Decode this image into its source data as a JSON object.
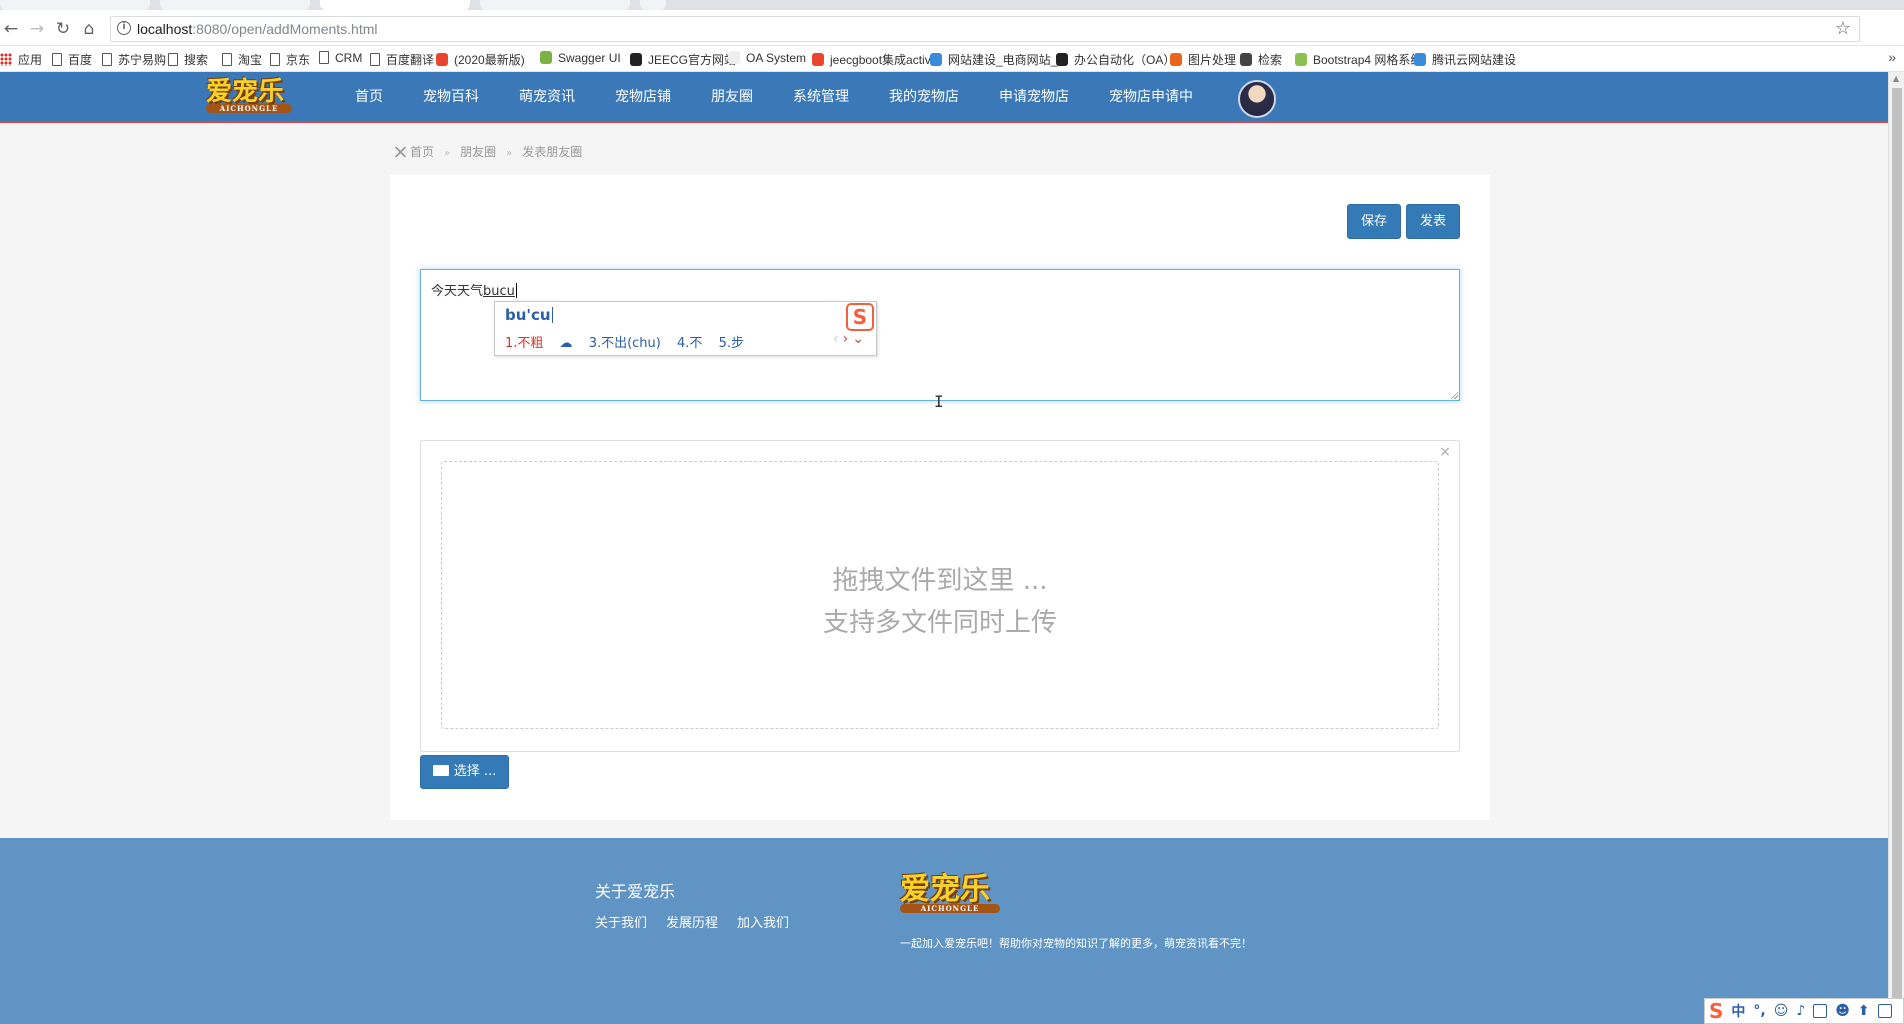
{
  "browser": {
    "url_host": "localhost",
    "url_rest": ":8080/open/addMoments.html",
    "bookmarks": [
      {
        "label": "应用",
        "icon": "apps-grid-icon"
      },
      {
        "label": "百度",
        "icon": "page-icon"
      },
      {
        "label": "苏宁易购",
        "icon": "page-icon"
      },
      {
        "label": "搜索",
        "icon": "page-icon"
      },
      {
        "label": "淘宝",
        "icon": "page-icon"
      },
      {
        "label": "京东",
        "icon": "page-icon"
      },
      {
        "label": "CRM",
        "icon": "page-icon"
      },
      {
        "label": "百度翻译",
        "icon": "page-icon"
      },
      {
        "label": "(2020最新版)",
        "icon": "c-brand-icon"
      },
      {
        "label": "Swagger UI",
        "icon": "swagger-icon"
      },
      {
        "label": "JEECG官方网站",
        "icon": "jeecg-icon"
      },
      {
        "label": "OA System",
        "icon": "blank-icon"
      },
      {
        "label": "jeecgboot集成activ",
        "icon": "g-brand-icon"
      },
      {
        "label": "网站建设_电商网站_",
        "icon": "cloud-icon"
      },
      {
        "label": "办公自动化（OA）",
        "icon": "github-icon"
      },
      {
        "label": "图片处理",
        "icon": "office-icon"
      },
      {
        "label": "检索",
        "icon": "fx-icon"
      },
      {
        "label": "Bootstrap4 网格系统",
        "icon": "bootstrap-icon"
      },
      {
        "label": "腾讯云网站建设",
        "icon": "cloud-icon"
      }
    ],
    "more_glyph": "»"
  },
  "site": {
    "logo_text": "爱宠乐",
    "logo_sub": "AICHONGLE",
    "nav": [
      "首页",
      "宠物百科",
      "萌宠资讯",
      "宠物店铺",
      "朋友圈",
      "系统管理",
      "我的宠物店",
      "申请宠物店",
      "宠物店申请中"
    ]
  },
  "breadcrumb": {
    "items": [
      "首页",
      "朋友圈",
      "发表朋友圈"
    ],
    "separator": "»"
  },
  "form": {
    "save_label": "保存",
    "publish_label": "发表",
    "editor_text": "今天天气",
    "editor_composing": "bucu",
    "upload_line1": "拖拽文件到这里 ...",
    "upload_line2": "支持多文件同时上传",
    "upload_close": "×",
    "choose_label": "选择 ..."
  },
  "ime": {
    "pinyin": "bu'cu",
    "logo": "S",
    "candidates": [
      "1.不粗",
      "3.不出(chu)",
      "4.不",
      "5.步"
    ],
    "pager_prev": "‹",
    "pager_next": "›",
    "pager_expand": "⌄"
  },
  "footer": {
    "about_title": "关于爱宠乐",
    "links": [
      "关于我们",
      "发展历程",
      "加入我们"
    ],
    "logo_text": "爱宠乐",
    "logo_sub": "AICHONGLE",
    "slogan": "一起加入爱宠乐吧！帮助你对宠物的知识了解的更多，萌宠资讯看不完！"
  },
  "ime_status": {
    "logo": "S",
    "mode": "中"
  },
  "colors": {
    "header_bg": "#3b78b7",
    "primary_button": "#337ab7",
    "footer_bg": "#5f94c4",
    "ime_accent": "#f5603c"
  }
}
